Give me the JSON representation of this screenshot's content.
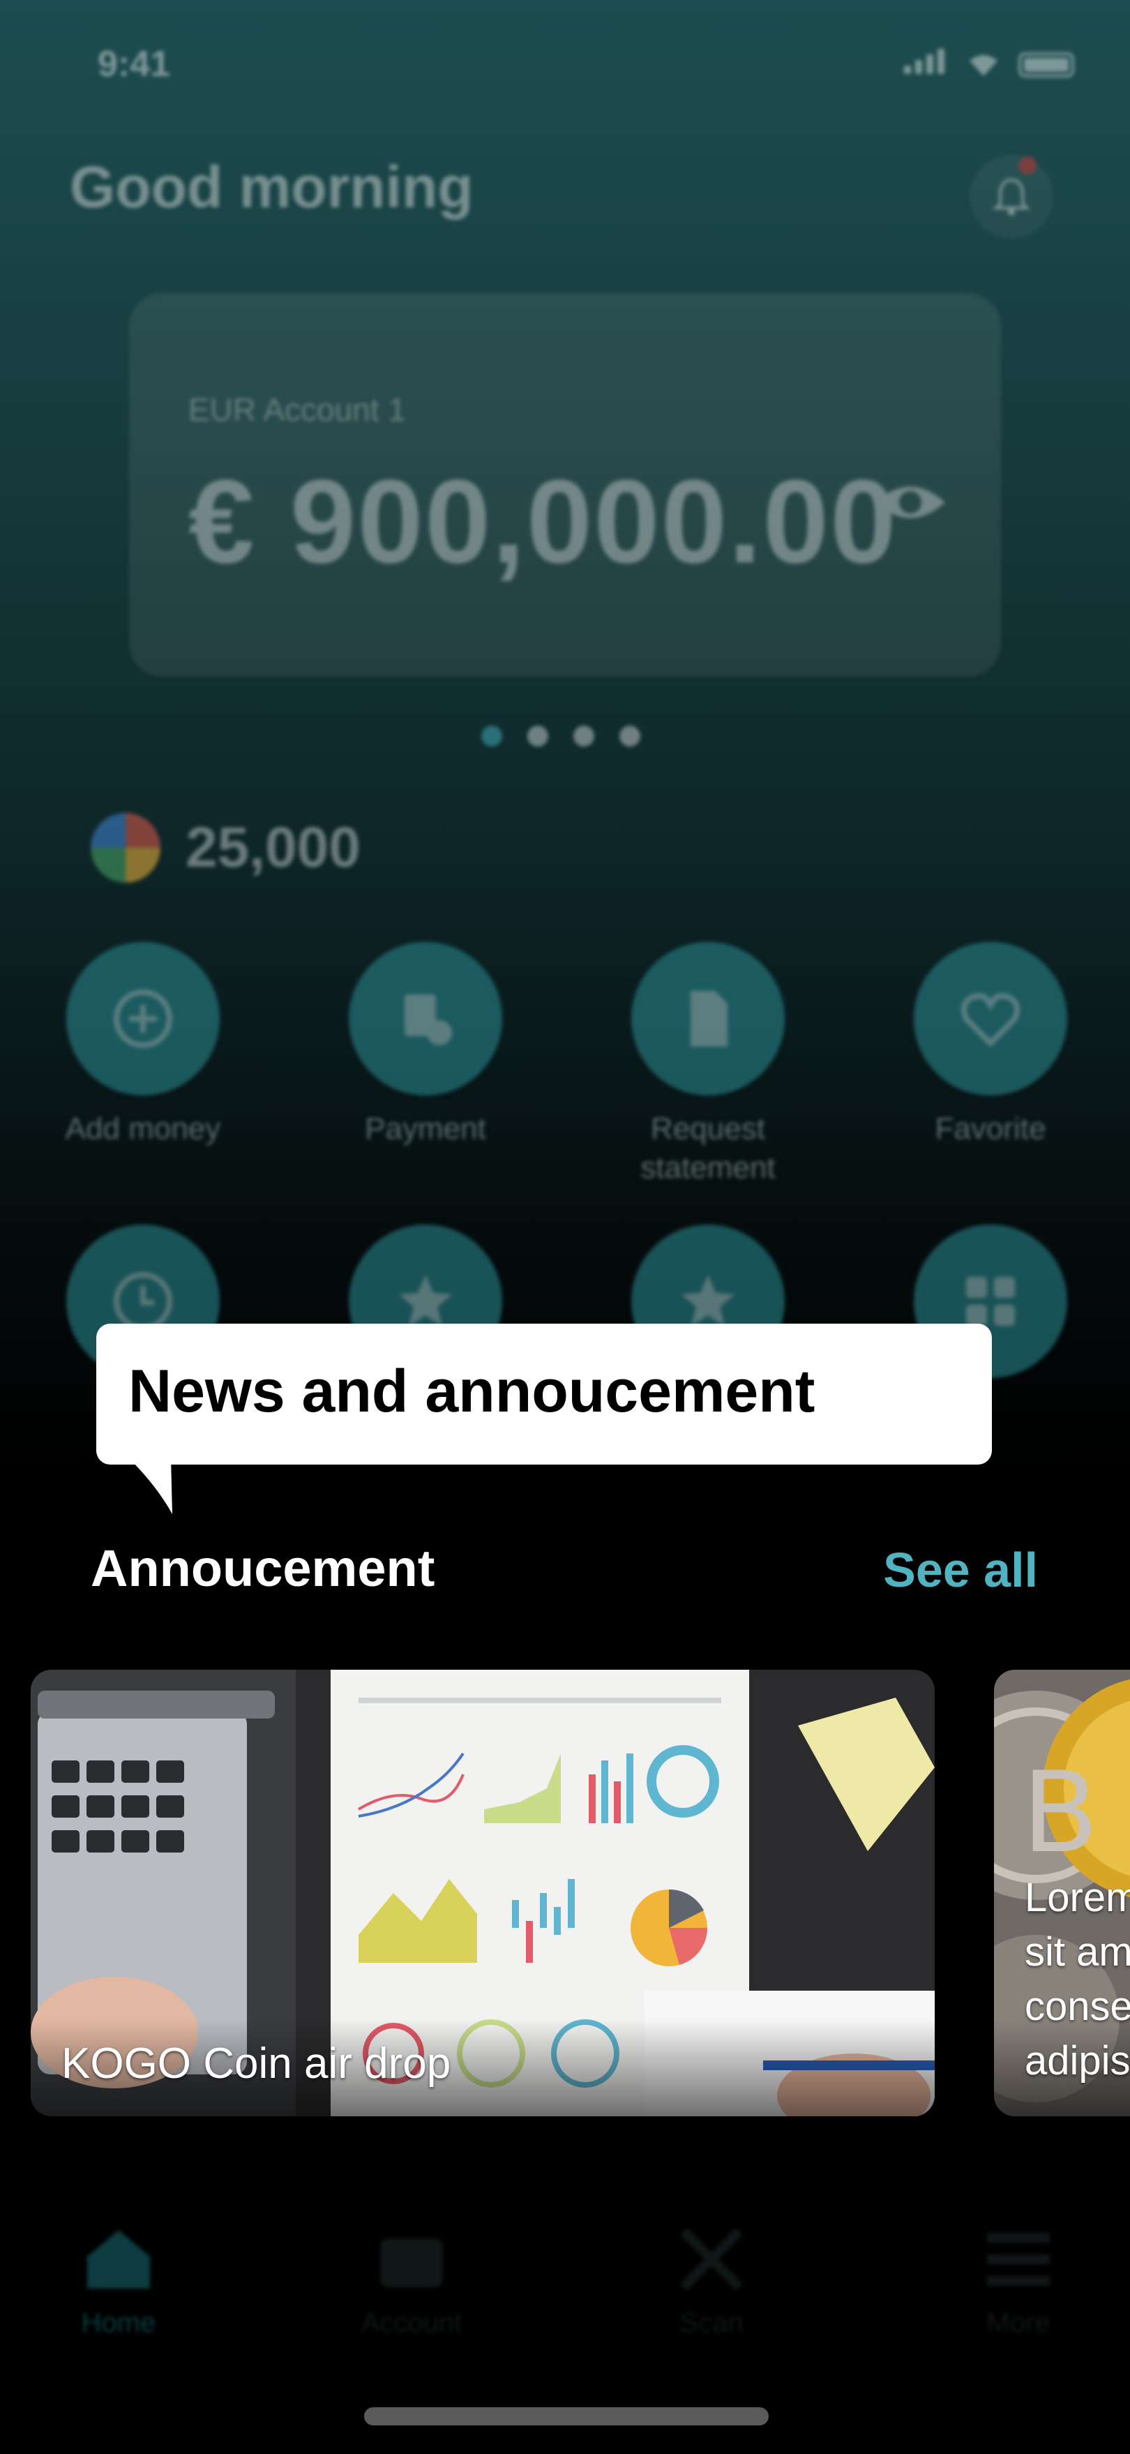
{
  "status_bar": {
    "time": "9:41"
  },
  "header": {
    "greeting": "Good morning"
  },
  "account_card": {
    "label": "EUR Account 1",
    "amount": "€ 900,000.00",
    "page_count": 4,
    "active_page": 0
  },
  "coins": {
    "value": "25,000"
  },
  "actions": [
    {
      "label": "Add money",
      "icon": "plus-circle-icon"
    },
    {
      "label": "Payment",
      "icon": "payment-icon"
    },
    {
      "label": "Request statement",
      "icon": "document-icon"
    },
    {
      "label": "Favorite",
      "icon": "heart-icon"
    }
  ],
  "actions_row2": [
    {
      "icon": "clock-icon"
    },
    {
      "icon": "star-icon"
    },
    {
      "icon": "star-icon"
    },
    {
      "icon": "grid-icon"
    }
  ],
  "tooltip": {
    "text": "News and annoucement"
  },
  "announcements": {
    "title": "Annoucement",
    "see_all": "See all",
    "cards": [
      {
        "caption": "KOGO  Coin air drop"
      },
      {
        "caption": "Lorem ipsum dolor sit amet, consectetur adipiscing"
      }
    ]
  },
  "bottom_nav": [
    {
      "label": "Home",
      "icon": "home-icon",
      "active": true
    },
    {
      "label": "Account",
      "icon": "wallet-icon",
      "active": false
    },
    {
      "label": "Scan",
      "icon": "scan-icon",
      "active": false
    },
    {
      "label": "More",
      "icon": "menu-icon",
      "active": false
    }
  ],
  "colors": {
    "accent": "#4fb3c0",
    "action_circle": "#2a8f96",
    "tooltip_bg": "#ffffff"
  }
}
